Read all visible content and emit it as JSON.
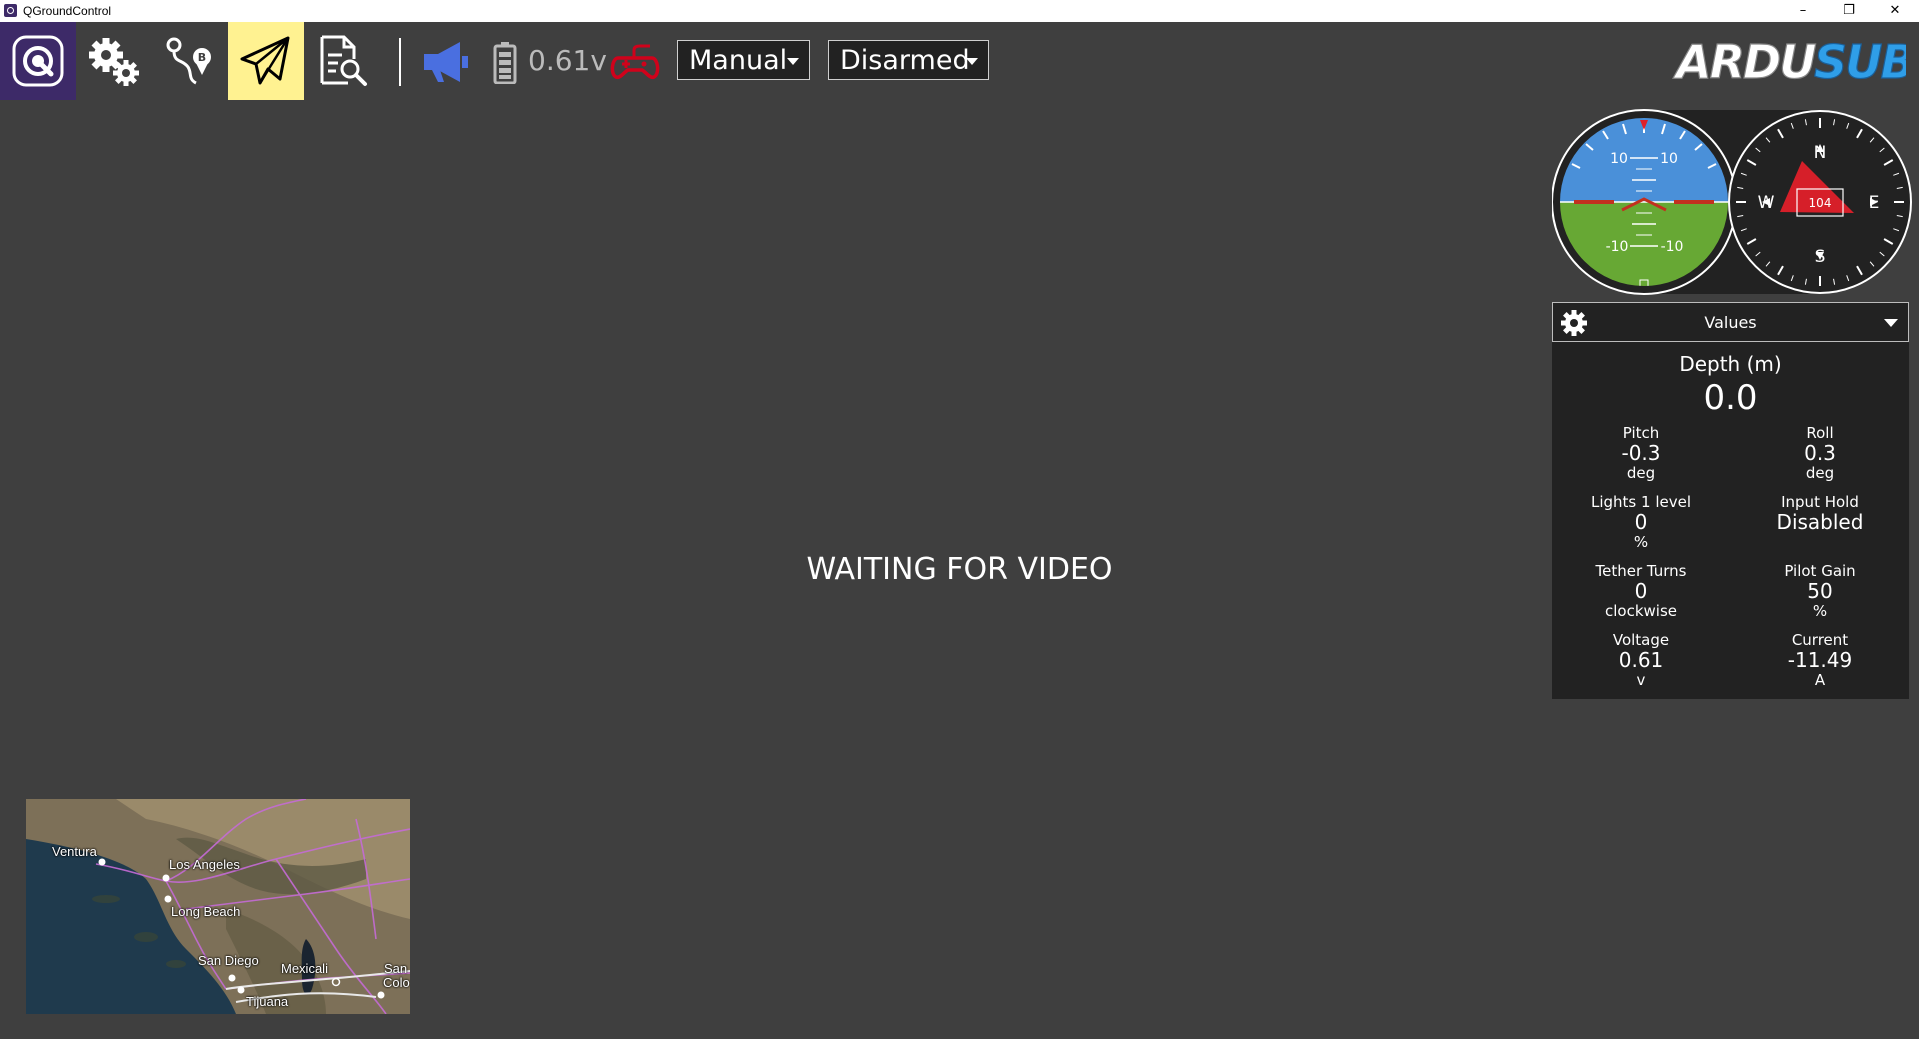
{
  "window": {
    "title": "QGroundControl",
    "controls": {
      "minimize": "–",
      "maximize": "❐",
      "close": "✕"
    }
  },
  "toolbar": {
    "buttons": [
      {
        "name": "qgc-logo",
        "icon": "qgc-logo-icon",
        "active": false
      },
      {
        "name": "vehicle-setup",
        "icon": "gears-icon",
        "active": false
      },
      {
        "name": "plan",
        "icon": "plan-route-icon",
        "active": false
      },
      {
        "name": "fly",
        "icon": "paper-plane-icon",
        "active": true
      },
      {
        "name": "analyze",
        "icon": "document-search-icon",
        "active": false
      }
    ],
    "battery_voltage": "0.61v",
    "flight_mode": "Manual",
    "arm_state": "Disarmed",
    "brand": "ARDUSUB"
  },
  "colors": {
    "background": "#3f3f3f",
    "logo_bg": "#3d2a68",
    "active_tab": "#fff291",
    "message_icon": "#4a6fe0",
    "joystick_icon": "#d0021b",
    "sky": "#4a90d9",
    "ground": "#67a834",
    "compass_arrow": "#e0202a"
  },
  "attitude": {
    "pitch_labels": [
      "10",
      "10",
      "-10",
      "-10"
    ]
  },
  "compass": {
    "n": "N",
    "e": "E",
    "s": "S",
    "w": "W",
    "heading": "104"
  },
  "values_widget": {
    "title": "Values",
    "depth": {
      "label": "Depth (m)",
      "value": "0.0"
    },
    "rows": [
      {
        "left": {
          "label": "Pitch",
          "value": "-0.3",
          "unit": "deg"
        },
        "right": {
          "label": "Roll",
          "value": "0.3",
          "unit": "deg"
        }
      },
      {
        "left": {
          "label": "Lights 1 level",
          "value": "0",
          "unit": "%"
        },
        "right": {
          "label": "Input Hold",
          "value": "Disabled",
          "unit": ""
        }
      },
      {
        "left": {
          "label": "Tether Turns",
          "value": "0",
          "unit": "clockwise"
        },
        "right": {
          "label": "Pilot Gain",
          "value": "50",
          "unit": "%"
        }
      },
      {
        "left": {
          "label": "Voltage",
          "value": "0.61",
          "unit": "v"
        },
        "right": {
          "label": "Current",
          "value": "-11.49",
          "unit": "A"
        }
      }
    ]
  },
  "video": {
    "message": "WAITING FOR VIDEO"
  },
  "minimap": {
    "labels": [
      "Ventura",
      "Los Angeles",
      "Long Beach",
      "San Diego",
      "Mexicali",
      "Tijuana",
      "San",
      "Colo"
    ]
  }
}
